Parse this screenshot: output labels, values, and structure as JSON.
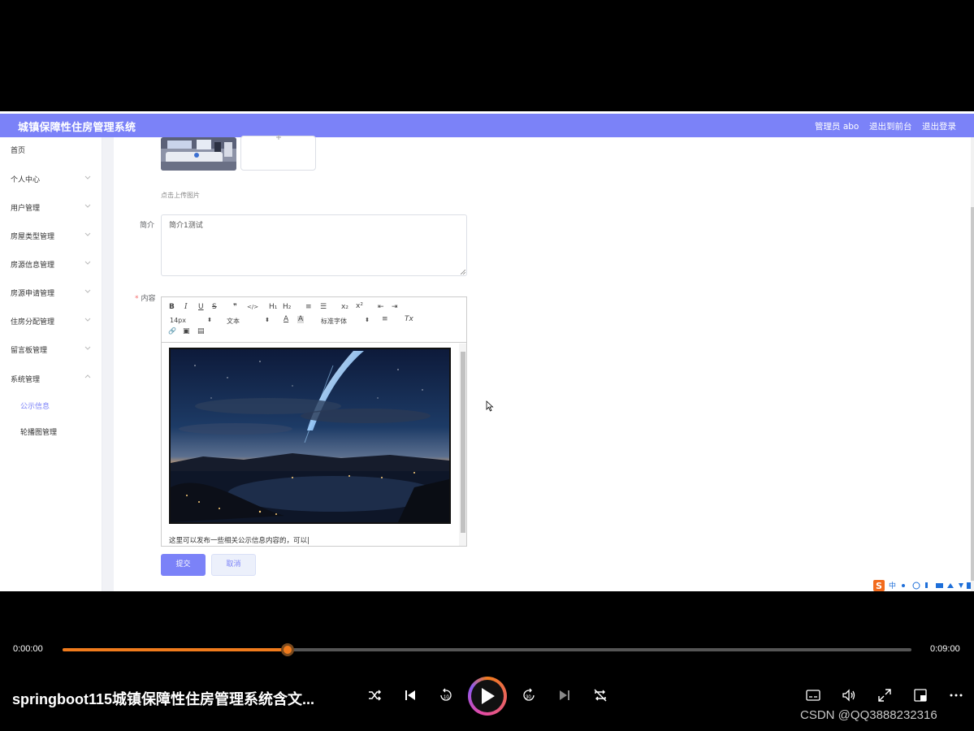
{
  "app": {
    "title": "城镇保障性住房管理系统",
    "admin_label": "管理员 abo",
    "to_frontend": "退出到前台",
    "logout": "退出登录",
    "brand_color": "#7b82f8"
  },
  "sidebar": {
    "items": [
      {
        "label": "首页"
      },
      {
        "label": "个人中心"
      },
      {
        "label": "用户管理"
      },
      {
        "label": "房屋类型管理"
      },
      {
        "label": "房源信息管理"
      },
      {
        "label": "房源申请管理"
      },
      {
        "label": "住房分配管理"
      },
      {
        "label": "留言板管理"
      },
      {
        "label": "系统管理"
      }
    ],
    "sub_items": [
      {
        "label": "公示信息",
        "active": true
      },
      {
        "label": "轮播图管理",
        "active": false
      }
    ]
  },
  "form": {
    "upload_hint": "点击上传图片",
    "intro_label": "简介",
    "intro_value": "简介1测试",
    "content_label": "内容",
    "content_required_mark": "*",
    "editor_text": "这里可以发布一些相关公示信息内容的，可以|",
    "toolbar": {
      "bold": "B",
      "italic": "I",
      "underline": "U",
      "strike": "S",
      "quote": "❞",
      "code": "</>",
      "h1": "H₁",
      "h2": "H₂",
      "ordered_list": "≡",
      "bullet_list": "☰",
      "subscript": "x₂",
      "superscript": "x²",
      "outdent": "⇤",
      "indent": "⇥",
      "size_value": "14px",
      "format_value": "文本",
      "font_color": "A",
      "bg_color": "A",
      "font_value": "标准字体",
      "align": "≡",
      "clear": "Tx",
      "link": "🔗",
      "image": "▣",
      "video": "▤"
    },
    "submit": "提交",
    "cancel": "取消"
  },
  "player": {
    "current_time": "0:00:00",
    "total_time": "0:09:00",
    "progress": 0.265,
    "title": "springboot115城镇保障性住房管理系统含文...",
    "rewind_label": "10",
    "forward_label": "30",
    "watermark": "CSDN @QQ3888232316",
    "accent_color": "#f07b1c"
  },
  "ime": {
    "label": "中"
  }
}
